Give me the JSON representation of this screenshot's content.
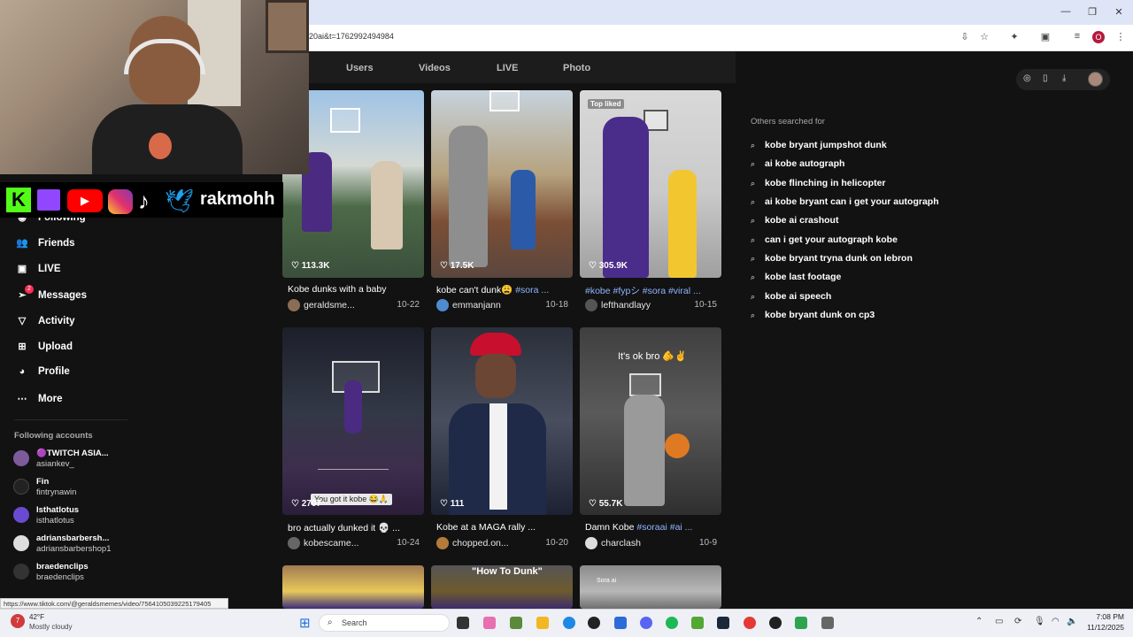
{
  "browser": {
    "url": "20ai&t=1762992494984",
    "toolbar_icons": [
      "install-icon",
      "star-icon",
      "extensions-icon",
      "media-icon",
      "tab-search-icon",
      "profile-icon",
      "kebab-menu-icon"
    ],
    "profile_letter": "O",
    "window_controls": {
      "minimize": "—",
      "maximize": "❐",
      "close": "✕"
    }
  },
  "stream_overlay": {
    "social_name": "rakmohh",
    "platform_icons": [
      "kick-icon",
      "twitch-icon",
      "youtube-icon",
      "instagram-icon",
      "tiktok-icon",
      "twitter-icon"
    ]
  },
  "search_tabs": [
    "Users",
    "Videos",
    "LIVE",
    "Photo"
  ],
  "sidebar": {
    "items": [
      {
        "label": "Following",
        "icon": "following-icon"
      },
      {
        "label": "Friends",
        "icon": "friends-icon"
      },
      {
        "label": "LIVE",
        "icon": "live-icon"
      },
      {
        "label": "Messages",
        "icon": "messages-icon",
        "badge": "2"
      },
      {
        "label": "Activity",
        "icon": "activity-icon"
      },
      {
        "label": "Upload",
        "icon": "upload-icon"
      },
      {
        "label": "Profile",
        "icon": "profile-icon"
      },
      {
        "label": "More",
        "icon": "more-icon"
      }
    ],
    "following_title": "Following accounts",
    "accounts": [
      {
        "name": "🟣TWITCH ASIA...",
        "handle": "asiankev_"
      },
      {
        "name": "Fin",
        "handle": "fintrynawin"
      },
      {
        "name": "Isthatlotus",
        "handle": "isthatlotus"
      },
      {
        "name": "adriansbarbersh...",
        "handle": "adriansbarbershop1"
      },
      {
        "name": "braedenclips",
        "handle": "braedenclips"
      }
    ]
  },
  "videos": [
    {
      "likes": "113.3K",
      "title": "Kobe dunks with a baby",
      "tags": "",
      "author": "geraldsme...",
      "date": "10-22",
      "badge": "",
      "caption": ""
    },
    {
      "likes": "17.5K",
      "title": "kobe can't dunk😩 ",
      "tags": "#sora ...",
      "author": "emmanjann",
      "date": "10-18",
      "badge": "",
      "caption": ""
    },
    {
      "likes": "305.9K",
      "title": "",
      "tags": "#kobe #fypシ #sora #viral ...",
      "author": "lefthandlayy",
      "date": "10-15",
      "badge": "Top liked",
      "caption": ""
    },
    {
      "likes": "2707",
      "title": "bro actually dunked it 💀 ...",
      "tags": "",
      "author": "kobescame...",
      "date": "10-24",
      "badge": "",
      "caption": "You got it kobe 😂🙏"
    },
    {
      "likes": "111",
      "title": "Kobe at a MAGA rally ...",
      "tags": "",
      "author": "chopped.on...",
      "date": "10-20",
      "badge": "",
      "caption": ""
    },
    {
      "likes": "55.7K",
      "title": "Damn Kobe ",
      "tags": "#soraai #ai ...",
      "author": "charclash",
      "date": "10-9",
      "badge": "",
      "caption": "It's ok bro 🫵✌️"
    }
  ],
  "third_row_captions": [
    "",
    "\"How To Dunk\"",
    "Sora ai"
  ],
  "right_panel": {
    "title": "Others searched for",
    "suggestions": [
      "kobe bryant jumpshot dunk",
      "ai kobe autograph",
      "kobe flinching in helicopter",
      "ai kobe bryant can i get your autograph",
      "kobe ai crashout",
      "can i get your autograph kobe",
      "kobe bryant tryna dunk on lebron",
      "kobe last footage",
      "kobe ai speech",
      "kobe bryant dunk on cp3"
    ]
  },
  "status_url": "https://www.tiktok.com/@geraldsmemes/video/7564105039225179405",
  "taskbar": {
    "weather_temp": "42°F",
    "weather_desc": "Mostly cloudy",
    "weather_badge": "7",
    "search_label": "Search",
    "time": "7:08 PM",
    "date": "11/12/2025"
  }
}
